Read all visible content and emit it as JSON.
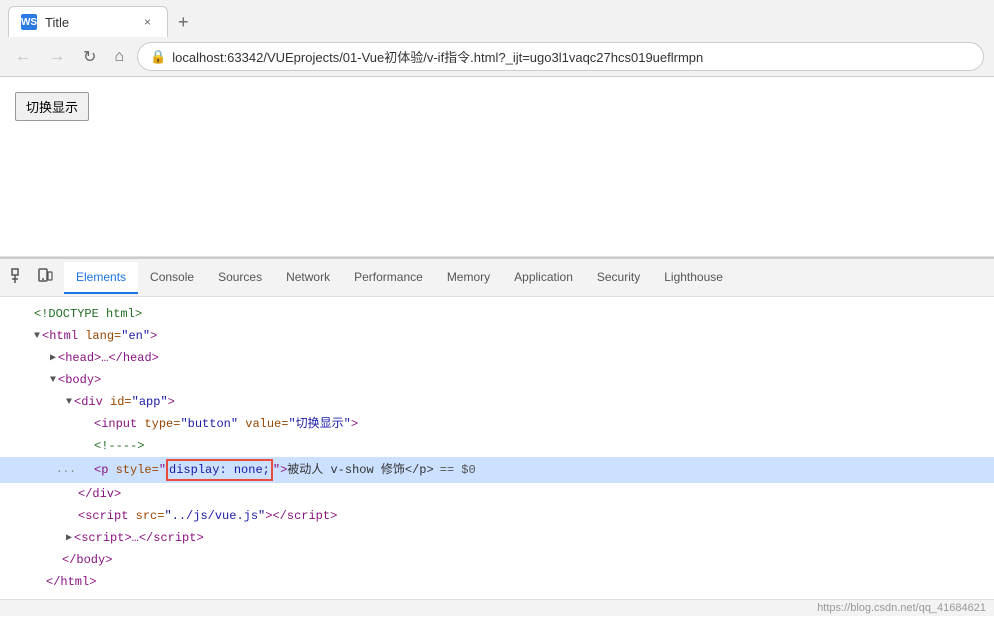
{
  "browser": {
    "tab_favicon": "WS",
    "tab_title": "Title",
    "tab_close": "×",
    "tab_new": "+",
    "nav_back": "←",
    "nav_forward": "→",
    "nav_refresh": "↻",
    "nav_home": "⌂",
    "url_icon": "🔒",
    "url": "localhost:63342/VUEprojects/01-Vue初体验/v-if指令.html?_ijt=ugo3l1vaqc27hcs019ueflrmpn"
  },
  "page": {
    "toggle_btn": "切换显示"
  },
  "devtools": {
    "icon_cursor": "⬚",
    "icon_device": "📱",
    "tabs": [
      {
        "label": "Elements",
        "active": true
      },
      {
        "label": "Console",
        "active": false
      },
      {
        "label": "Sources",
        "active": false
      },
      {
        "label": "Network",
        "active": false
      },
      {
        "label": "Performance",
        "active": false
      },
      {
        "label": "Memory",
        "active": false
      },
      {
        "label": "Application",
        "active": false
      },
      {
        "label": "Security",
        "active": false
      },
      {
        "label": "Lighthouse",
        "active": false
      }
    ]
  },
  "dom": {
    "lines": [
      {
        "indent": 0,
        "content_type": "comment",
        "text": "<!DOCTYPE html>"
      },
      {
        "indent": 0,
        "content_type": "tag_open",
        "text": "<html lang=\"en\">"
      },
      {
        "indent": 1,
        "content_type": "collapsed",
        "tag": "head",
        "text": "▶ <head>…</head>"
      },
      {
        "indent": 1,
        "content_type": "tag_open_triangle",
        "tag": "body",
        "text": "▼ <body>"
      },
      {
        "indent": 2,
        "content_type": "tag_open_triangle",
        "tag": "div",
        "text": "▼ <div id=\"app\">"
      },
      {
        "indent": 3,
        "content_type": "input_tag",
        "text": "<input type=\"button\" value=\"切换显示\">"
      },
      {
        "indent": 3,
        "content_type": "comment",
        "text": "<!---->"
      },
      {
        "indent": 3,
        "content_type": "highlighted",
        "pre": "<p style=",
        "highlight": "display: none;",
        "post": ">被动人 v-show 修饰</p>",
        "extra": " == $0"
      },
      {
        "indent": 2,
        "content_type": "tag_close",
        "text": "</div>"
      },
      {
        "indent": 2,
        "content_type": "script_src",
        "text": "<script src=\"../js/vue.js\"></script>"
      },
      {
        "indent": 2,
        "content_type": "collapsed_script",
        "text": "▶ <script>…</script>"
      },
      {
        "indent": 1,
        "content_type": "tag_close",
        "text": "</body>"
      },
      {
        "indent": 0,
        "content_type": "tag_close",
        "text": "</html>"
      }
    ]
  },
  "status_bar": {
    "text": "https://blog.csdn.net/qq_41684621"
  }
}
